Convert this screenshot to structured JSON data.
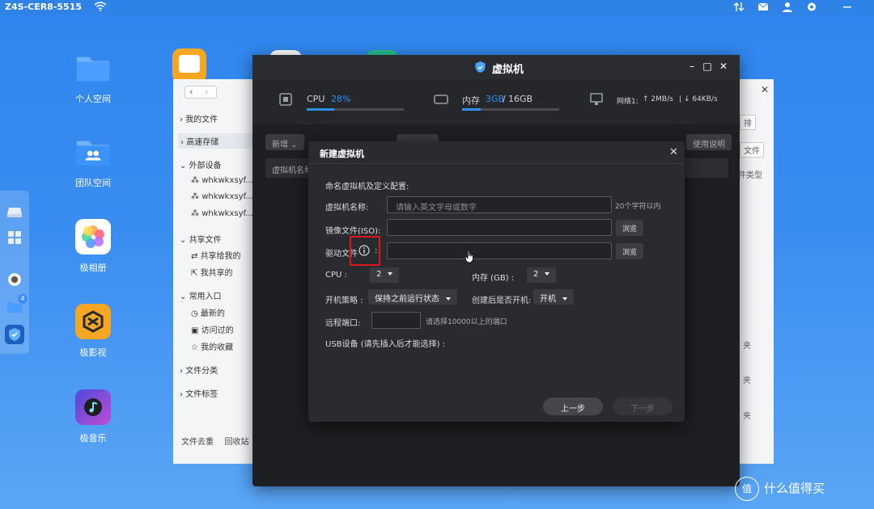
{
  "topbar": {
    "host": "Z4S-CER8-5515"
  },
  "desktop": {
    "icons": [
      {
        "label": "个人空间",
        "icon": "folder-icon"
      },
      {
        "label": "团队空间",
        "icon": "team-folder-icon"
      },
      {
        "label": "极相册",
        "icon": "photos-icon"
      },
      {
        "label": "极影视",
        "icon": "video-icon"
      },
      {
        "label": "极音乐",
        "icon": "music-icon"
      }
    ],
    "dock_badge": "4"
  },
  "file_manager": {
    "sidebar": {
      "my_files": "我的文件",
      "fast_storage": "高速存储",
      "external": "外部设备",
      "devices": [
        "whkwkxsyf...",
        "whkwkxsyf...",
        "whkwkxsyf..."
      ],
      "shared_files": "共享文件",
      "shared_to_me": "共享给我的",
      "my_shared": "我共享的",
      "common_entry": "常用入口",
      "recent": "最新的",
      "visited": "访问过的",
      "favorites": "我的收藏",
      "file_category": "文件分类",
      "file_tags": "文件标签",
      "file_transfer": "文件去重",
      "recycle": "回收站"
    },
    "right_partial": {
      "sort": "排",
      "btn": "文件",
      "type": "件类型",
      "rows": [
        "夹",
        "夹",
        "夹"
      ]
    }
  },
  "vm_window": {
    "title": "虚拟机",
    "cpu": {
      "label": "CPU",
      "value": "28%",
      "progress": 0.28
    },
    "memory": {
      "label": "内存",
      "used": "3GB",
      "sep": "/",
      "total": "16GB",
      "progress": 0.19
    },
    "network": {
      "label": "网络1:",
      "up": "↑ 2MB/s",
      "sep": "|",
      "down": "↓ 64KB/s"
    },
    "toolbar": {
      "new": "新增",
      "help": "使用说明"
    },
    "table_header": "虚拟机名称"
  },
  "dialog": {
    "title": "新建虚拟机",
    "section": "命名虚拟机及定义配置:",
    "name_label": "虚拟机名称:",
    "name_placeholder": "请输入英文字母或数字",
    "name_hint": "20个字符以内",
    "iso_label": "镜像文件(ISO):",
    "iso_browse": "浏览",
    "driver_label": "驱动文件",
    "driver_colon": ":",
    "driver_browse": "浏览",
    "cpu_label": "CPU :",
    "cpu_value": "2",
    "mem_label": "内存 (GB) :",
    "mem_value": "2",
    "boot_label": "开机策略 :",
    "boot_value": "保持之前运行状态",
    "autostart_label": "创建后是否开机:",
    "autostart_value": "开机",
    "remote_port_label": "远程端口:",
    "remote_port_value": "",
    "remote_port_hint": "请选择10000以上的端口",
    "usb_label": "USB设备 (请先插入后才能选择) :",
    "prev_button": "上一步",
    "next_button": "下一步"
  },
  "watermark": {
    "text": "什么值得买",
    "logo": "值"
  }
}
